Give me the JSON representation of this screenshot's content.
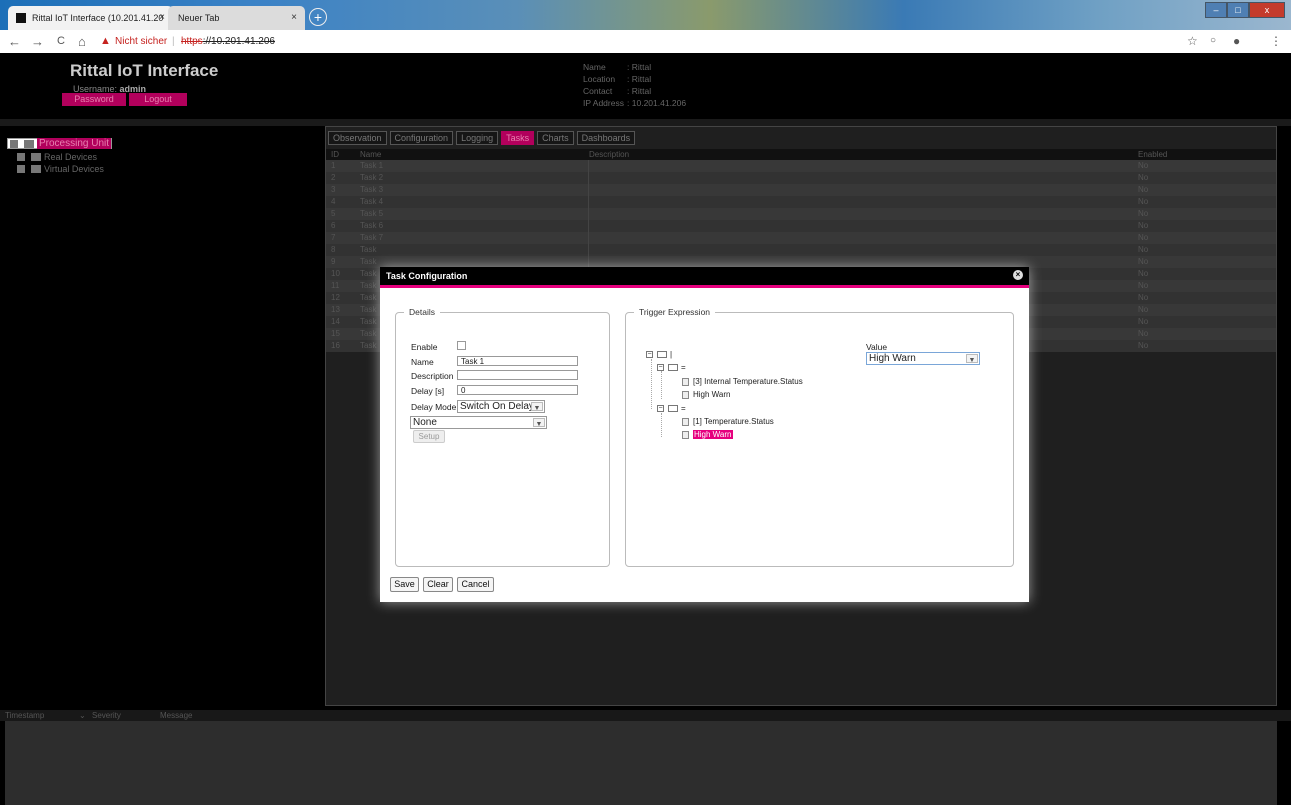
{
  "browser": {
    "tabs": [
      {
        "label": "Rittal IoT Interface (10.201.41.20",
        "close": "×"
      },
      {
        "label": "Neuer Tab",
        "close": "×"
      }
    ],
    "new_tab": "+",
    "address": {
      "security": "Nicht sicher",
      "sep": "|",
      "scheme": "https",
      "host": "://10.201.41.206"
    },
    "nav": {
      "back": "←",
      "forward": "→",
      "reload": "C",
      "home": "⌂"
    },
    "window": {
      "minimize": "–",
      "maximize": "□",
      "close": "x"
    }
  },
  "app": {
    "title": "Rittal IoT Interface",
    "user_label": "Username:",
    "user": "admin",
    "password_button": "Password",
    "logout_button": "Logout",
    "info": [
      {
        "key": "Name",
        "sep": ":",
        "value": "Rittal"
      },
      {
        "key": "Location",
        "sep": ":",
        "value": "Rittal"
      },
      {
        "key": "Contact",
        "sep": ":",
        "value": "Rittal"
      },
      {
        "key": "IP Address",
        "sep": ":",
        "value": "10.201.41.206"
      }
    ]
  },
  "tree": {
    "items": [
      "Processing Unit",
      "Real Devices",
      "Virtual Devices"
    ]
  },
  "main": {
    "tabs": [
      "Observation",
      "Configuration",
      "Logging",
      "Tasks",
      "Charts",
      "Dashboards"
    ],
    "columns": {
      "id": "ID",
      "name": "Name",
      "desc": "Description",
      "enabled": "Enabled"
    },
    "rows": [
      {
        "id": "1",
        "name": "Task 1",
        "enabled": "No"
      },
      {
        "id": "2",
        "name": "Task 2",
        "enabled": "No"
      },
      {
        "id": "3",
        "name": "Task 3",
        "enabled": "No"
      },
      {
        "id": "4",
        "name": "Task 4",
        "enabled": "No"
      },
      {
        "id": "5",
        "name": "Task 5",
        "enabled": "No"
      },
      {
        "id": "6",
        "name": "Task 6",
        "enabled": "No"
      },
      {
        "id": "7",
        "name": "Task 7",
        "enabled": "No"
      },
      {
        "id": "8",
        "name": "Task",
        "enabled": "No"
      },
      {
        "id": "9",
        "name": "Task",
        "enabled": "No"
      },
      {
        "id": "10",
        "name": "Task",
        "enabled": "No"
      },
      {
        "id": "11",
        "name": "Task",
        "enabled": "No"
      },
      {
        "id": "12",
        "name": "Task",
        "enabled": "No"
      },
      {
        "id": "13",
        "name": "Task",
        "enabled": "No"
      },
      {
        "id": "14",
        "name": "Task",
        "enabled": "No"
      },
      {
        "id": "15",
        "name": "Task",
        "enabled": "No"
      },
      {
        "id": "16",
        "name": "Task",
        "enabled": "No"
      }
    ]
  },
  "log": {
    "timestamp": "Timestamp",
    "sort": "⌄",
    "severity": "Severity",
    "message": "Message"
  },
  "modal": {
    "title": "Task Configuration",
    "close": "×",
    "details": {
      "legend": "Details",
      "enable_label": "Enable",
      "name_label": "Name",
      "name_value": "Task 1",
      "description_label": "Description",
      "description_value": "",
      "delay_label": "Delay [s]",
      "delay_value": "0",
      "delay_mode_label": "Delay Mode",
      "delay_mode_value": "Switch On Delay",
      "action_value": "None",
      "setup_button": "Setup"
    },
    "trigger": {
      "legend": "Trigger Expression",
      "root": "|",
      "eq1": "=",
      "leaf1a": "[3] Internal Temperature.Status",
      "leaf1b": "High Warn",
      "eq2": "=",
      "leaf2a": "[1] Temperature.Status",
      "leaf2b": "High Warn",
      "value_label": "Value",
      "value_select": "High Warn"
    },
    "buttons": {
      "save": "Save",
      "clear": "Clear",
      "cancel": "Cancel"
    }
  }
}
